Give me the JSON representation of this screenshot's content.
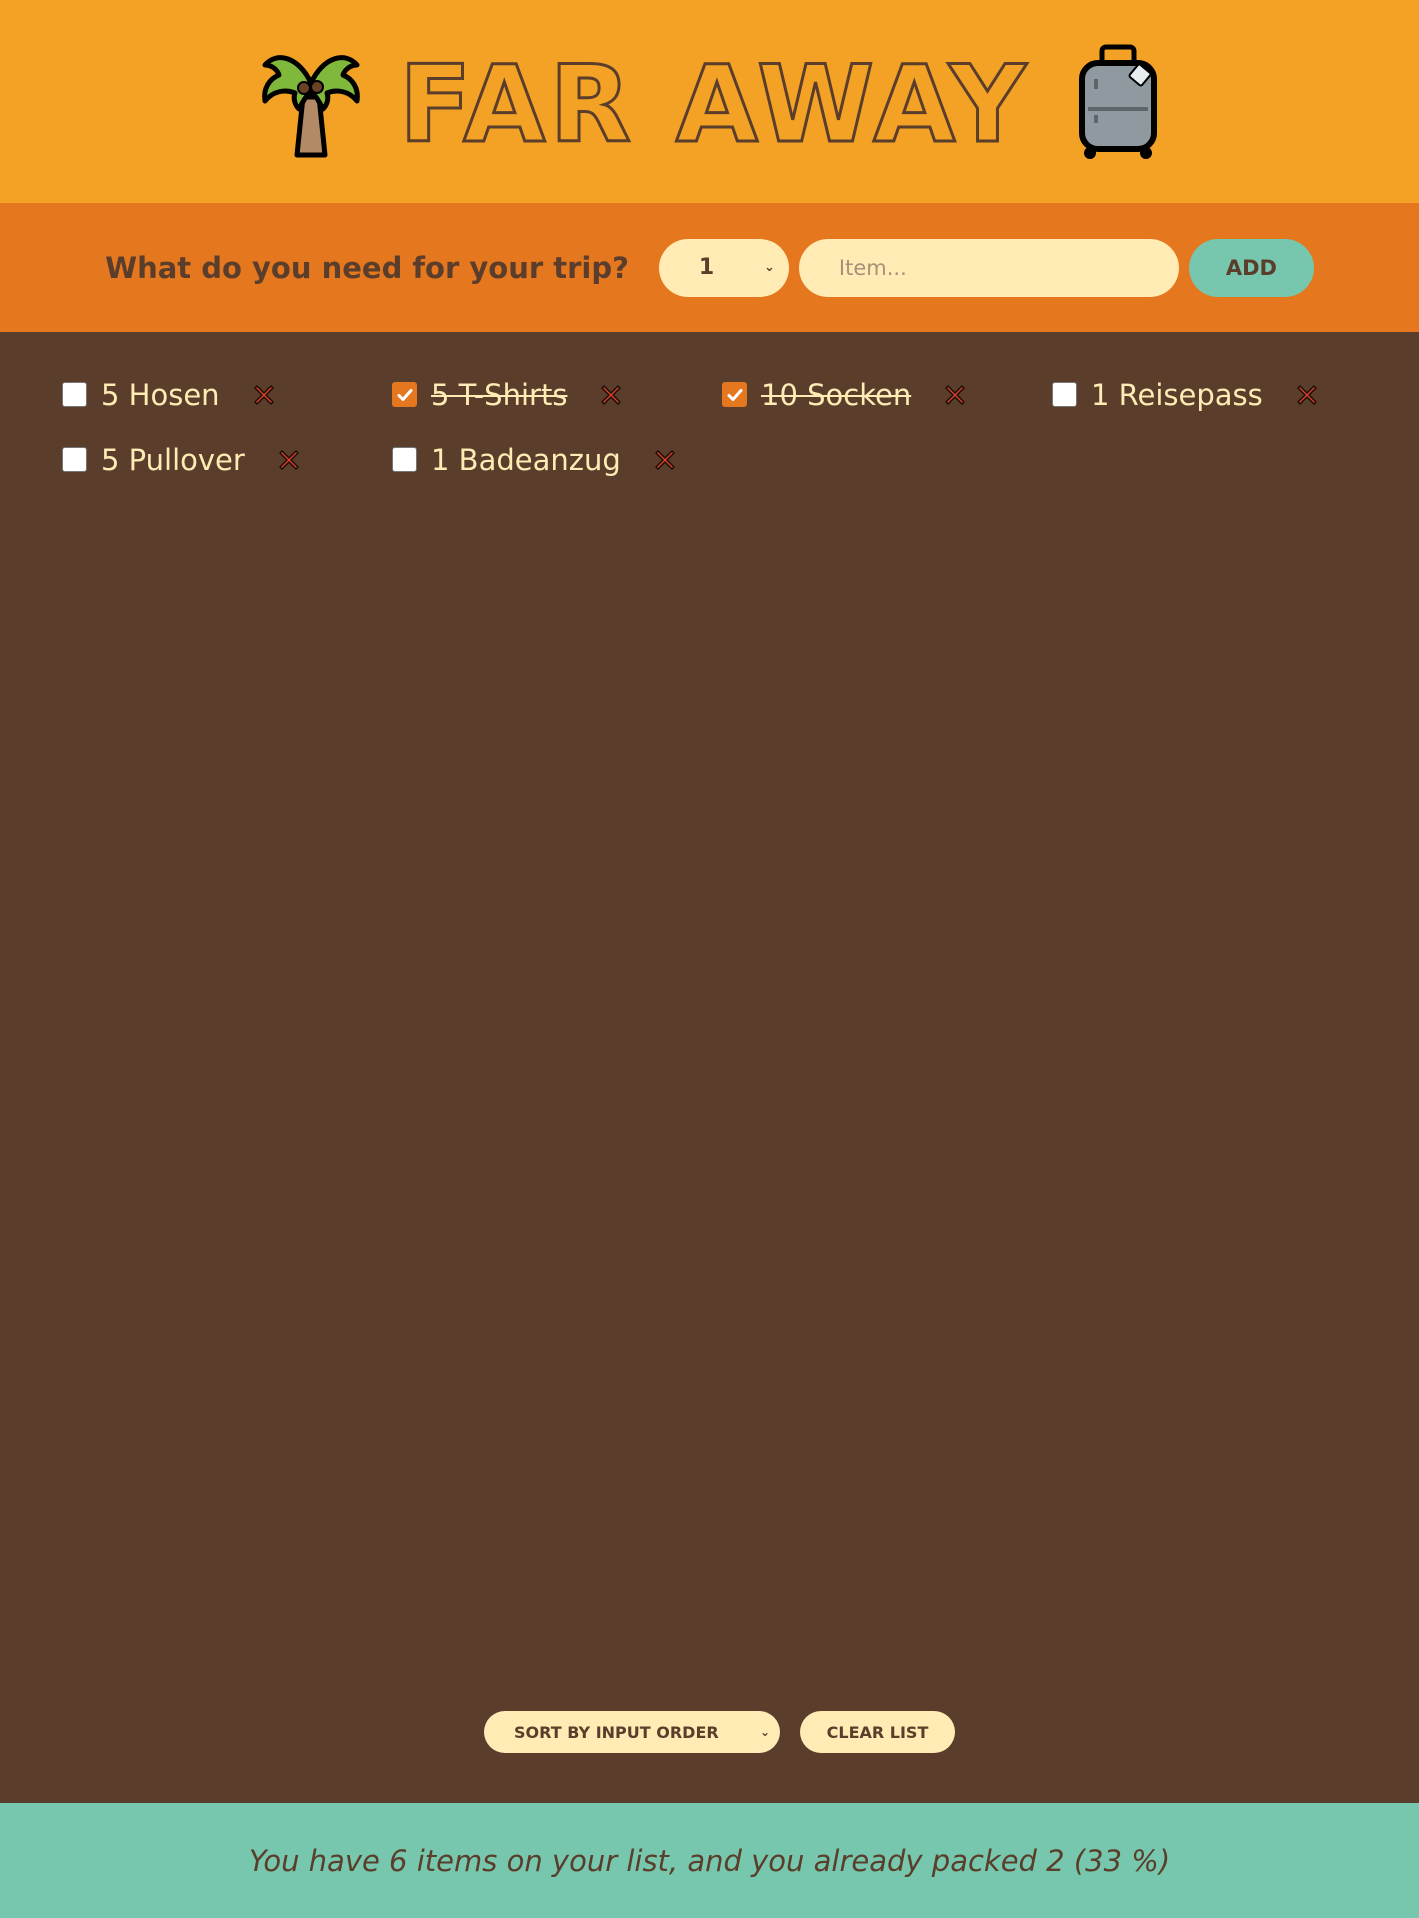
{
  "header": {
    "title": "FAR AWAY",
    "left_icon": "palm-tree-icon",
    "right_icon": "luggage-icon"
  },
  "form": {
    "question": "What do you need for your trip?",
    "quantity_value": "1",
    "item_placeholder": "Item...",
    "item_value": "",
    "add_label": "ADD"
  },
  "items": [
    {
      "label": "5 Hosen",
      "packed": false
    },
    {
      "label": "5 T-Shirts",
      "packed": true
    },
    {
      "label": "10 Socken",
      "packed": true
    },
    {
      "label": "1 Reisepass",
      "packed": false
    },
    {
      "label": "5 Pullover",
      "packed": false
    },
    {
      "label": "1 Badeanzug",
      "packed": false
    }
  ],
  "actions": {
    "sort_value": "SORT BY INPUT ORDER",
    "clear_label": "CLEAR LIST"
  },
  "stats": {
    "text": "You have 6 items on your list, and you already packed 2 (33 %)"
  },
  "colors": {
    "header_bg": "#f4a226",
    "form_bg": "#e5771f",
    "list_bg": "#5a3e2b",
    "stats_bg": "#76c7ad",
    "cream": "#ffebb3",
    "delete_red": "#e0402a"
  }
}
